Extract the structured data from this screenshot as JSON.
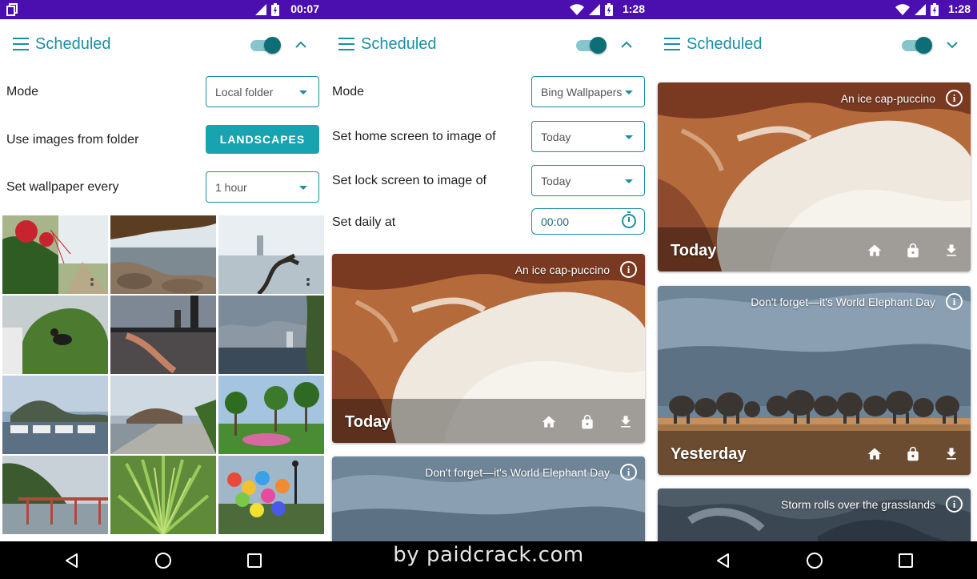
{
  "screens": [
    {
      "status": {
        "time": "00:07"
      },
      "app": {
        "title": "Scheduled"
      },
      "settings": {
        "mode_label": "Mode",
        "mode_value": "Local folder",
        "folder_label": "Use images from folder",
        "folder_button": "LANDSCAPES",
        "every_label": "Set wallpaper every",
        "every_value": "1 hour"
      }
    },
    {
      "status": {
        "time": "1:28"
      },
      "app": {
        "title": "Scheduled"
      },
      "settings": {
        "mode_label": "Mode",
        "mode_value": "Bing Wallpapers",
        "home_label": "Set home screen to image of",
        "home_value": "Today",
        "lock_label": "Set lock screen to image of",
        "lock_value": "Today",
        "daily_label": "Set daily at",
        "daily_value": "00:00"
      },
      "cards": [
        {
          "caption": "An ice cap-puccino",
          "day": "Today"
        },
        {
          "caption": "Don't forget—it's World Elephant Day",
          "day": ""
        }
      ]
    },
    {
      "status": {
        "time": "1:28"
      },
      "app": {
        "title": "Scheduled"
      },
      "cards": [
        {
          "caption": "An ice cap-puccino",
          "day": "Today"
        },
        {
          "caption": "Don't forget—it's World Elephant Day",
          "day": "Yesterday"
        },
        {
          "caption": "Storm rolls over the grasslands",
          "day": ""
        }
      ]
    }
  ],
  "watermark": "by paidcrack.com",
  "colors": {
    "accent": "#1a8fa3",
    "status_bar": "#4b0fb0",
    "button": "#17a3b0"
  },
  "icons": [
    "menu-icon",
    "chevron-up-icon",
    "chevron-down-icon",
    "home-icon",
    "lock-icon",
    "download-icon",
    "info-icon",
    "timer-icon",
    "back-icon",
    "home-circle-icon",
    "recents-icon"
  ]
}
